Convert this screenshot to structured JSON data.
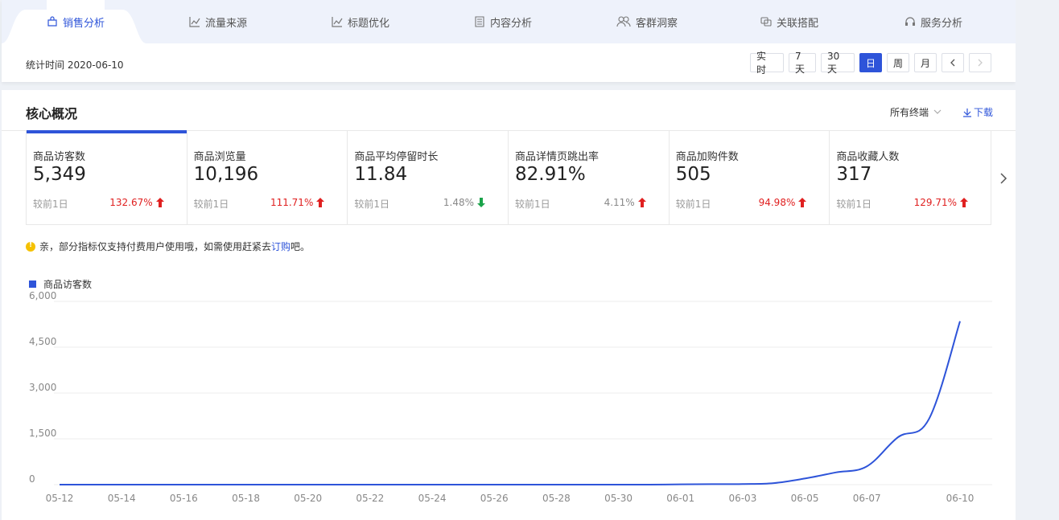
{
  "tabs": [
    {
      "label": "销售分析",
      "icon": "bag-icon",
      "active": true
    },
    {
      "label": "流量来源",
      "icon": "trend-icon"
    },
    {
      "label": "标题优化",
      "icon": "trend-icon"
    },
    {
      "label": "内容分析",
      "icon": "document-icon"
    },
    {
      "label": "客群洞察",
      "icon": "users-icon"
    },
    {
      "label": "关联搭配",
      "icon": "link-icon"
    },
    {
      "label": "服务分析",
      "icon": "headset-icon"
    }
  ],
  "stat_time": "统计时间 2020-06-10",
  "time_buttons": [
    "实 时",
    "7天",
    "30天",
    "日",
    "周",
    "月"
  ],
  "active_time": "日",
  "section_title": "核心概况",
  "terminal_filter": "所有终端",
  "download_label": "下载",
  "metrics": [
    {
      "label": "商品访客数",
      "value": "5,349",
      "compare": "较前1日",
      "pct": "132.67%",
      "dir": "up"
    },
    {
      "label": "商品浏览量",
      "value": "10,196",
      "compare": "较前1日",
      "pct": "111.71%",
      "dir": "up"
    },
    {
      "label": "商品平均停留时长",
      "value": "11.84",
      "compare": "较前1日",
      "pct": "1.48%",
      "dir": "down"
    },
    {
      "label": "商品详情页跳出率",
      "value": "82.91%",
      "compare": "较前1日",
      "pct": "4.11%",
      "dir": "up"
    },
    {
      "label": "商品加购件数",
      "value": "505",
      "compare": "较前1日",
      "pct": "94.98%",
      "dir": "up"
    },
    {
      "label": "商品收藏人数",
      "value": "317",
      "compare": "较前1日",
      "pct": "129.71%",
      "dir": "up"
    }
  ],
  "notice": {
    "text": "亲，部分指标仅支持付费用户使用哦，如需使用赶紧去 ",
    "link": "订购",
    "suffix": "吧。"
  },
  "colors": {
    "accent": "#2e54d9",
    "up": "#e02020",
    "down": "#1aa34a"
  },
  "chart_data": {
    "type": "line",
    "series": [
      {
        "name": "商品访客数"
      }
    ],
    "x": [
      "05-12",
      "05-13",
      "05-14",
      "05-15",
      "05-16",
      "05-17",
      "05-18",
      "05-19",
      "05-20",
      "05-21",
      "05-22",
      "05-23",
      "05-24",
      "05-25",
      "05-26",
      "05-27",
      "05-28",
      "05-29",
      "05-30",
      "05-31",
      "06-01",
      "06-02",
      "06-03",
      "06-04",
      "06-05",
      "06-06",
      "06-07",
      "06-08",
      "06-09",
      "06-10"
    ],
    "values": [
      0,
      0,
      0,
      0,
      0,
      0,
      0,
      0,
      0,
      0,
      0,
      0,
      0,
      0,
      0,
      0,
      0,
      0,
      0,
      0,
      10,
      15,
      20,
      50,
      200,
      400,
      600,
      1550,
      2150,
      5349
    ],
    "x_tick_labels": [
      "05-12",
      "05-14",
      "05-16",
      "05-18",
      "05-20",
      "05-22",
      "05-24",
      "05-26",
      "05-28",
      "05-30",
      "06-01",
      "06-03",
      "06-05",
      "06-07",
      "06-10"
    ],
    "y_ticks": [
      "0",
      "1,500",
      "3,000",
      "4,500",
      "6,000"
    ],
    "ylim": [
      0,
      6000
    ],
    "grid": true,
    "legend": "top-left"
  }
}
